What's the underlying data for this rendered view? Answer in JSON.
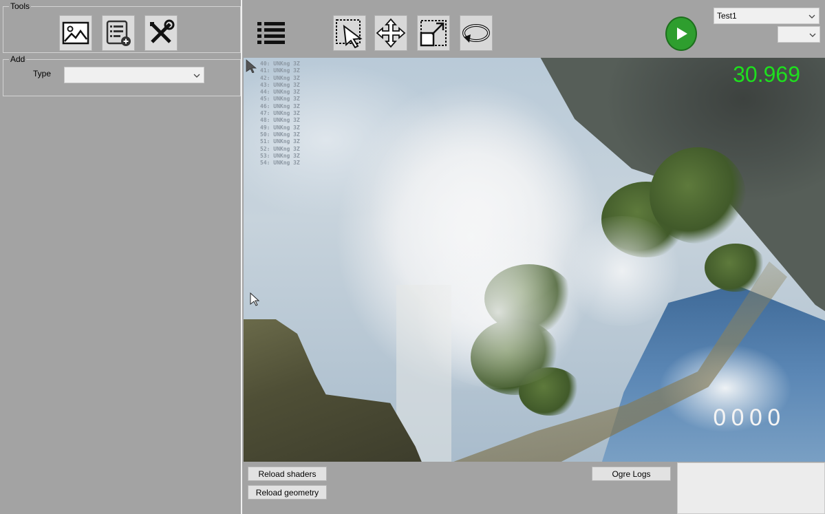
{
  "left_panel": {
    "tools_legend": "Tools",
    "tools": [
      {
        "name": "image-icon"
      },
      {
        "name": "list-add-icon"
      },
      {
        "name": "wrench-screwdriver-icon"
      }
    ],
    "add_legend": "Add",
    "type_label": "Type",
    "type_value": ""
  },
  "toolbar": {
    "buttons": [
      {
        "name": "list-icon"
      },
      {
        "name": "select-arrow-icon"
      },
      {
        "name": "move-arrows-icon"
      },
      {
        "name": "scale-icon"
      },
      {
        "name": "rotate-icon"
      }
    ],
    "play_icon": "play-icon",
    "play_color": "#2e9e2e",
    "scene_value": "Test1",
    "secondary_value": ""
  },
  "viewport": {
    "debug_lines": [
      "40: UNKng 3Z",
      "41: UNKng 3Z",
      "42: UNKng 3Z",
      "43: UNKng 3Z",
      "44: UNKng 3Z",
      "45: UNKng 3Z",
      "46: UNKng 3Z",
      "47: UNKng 3Z",
      "48: UNKng 3Z",
      "49: UNKng 3Z",
      "50: UNKng 3Z",
      "51: UNKng 3Z",
      "52: UNKng 3Z",
      "53: UNKng 3Z",
      "54: UNKng 3Z"
    ],
    "fps": "30.969",
    "fps_color": "#1ee01e",
    "counter": "0000"
  },
  "bottom": {
    "reload_shaders": "Reload shaders",
    "reload_geometry": "Reload geometry",
    "ogre_logs": "Ogre Logs"
  }
}
